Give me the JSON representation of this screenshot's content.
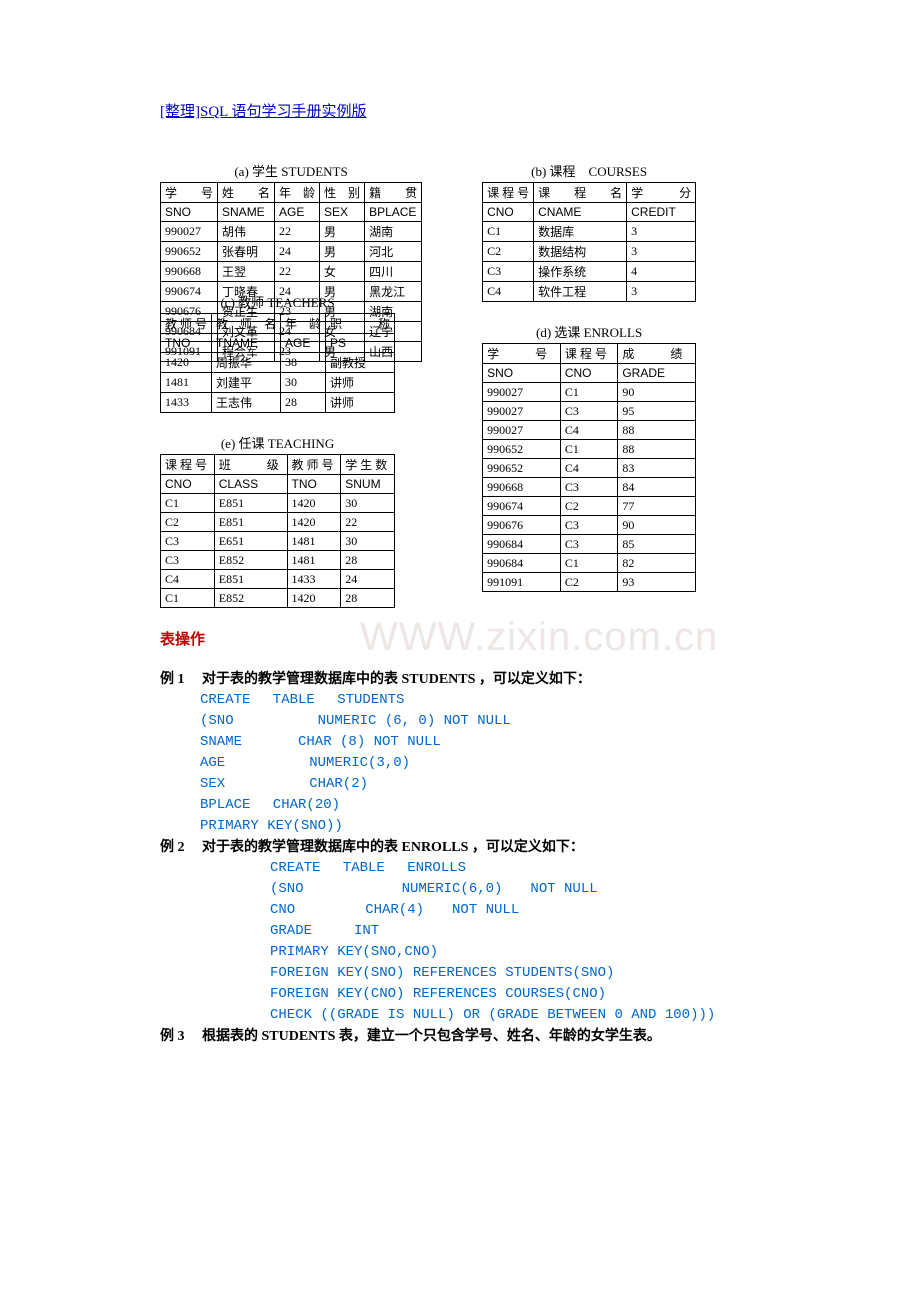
{
  "title": "[整理]SQL 语句学习手册实例版",
  "tbl_a": {
    "cap": "(a) 学生 STUDENTS",
    "h": [
      "学　　号",
      "姓　　名",
      "年　龄",
      "性　别",
      "籍　　贯"
    ],
    "h2": [
      "SNO",
      "SNAME",
      "AGE",
      "SEX",
      "BPLACE"
    ],
    "rows": [
      [
        "990027",
        "胡伟",
        "22",
        "男",
        "湖南"
      ],
      [
        "990652",
        "张春明",
        "24",
        "男",
        "河北"
      ],
      [
        "990668",
        "王翌",
        "22",
        "女",
        "四川"
      ],
      [
        "990674",
        "丁晓春",
        "24",
        "男",
        "黑龙江"
      ],
      [
        "990676",
        "贺正生",
        "23",
        "男",
        "湖南"
      ],
      [
        "990684",
        "刘文革",
        "24",
        "女",
        "辽宁"
      ],
      [
        "991091",
        "程会军",
        "23",
        "男",
        "山西"
      ]
    ]
  },
  "tbl_b": {
    "cap": "(b) 课程　COURSES",
    "h": [
      "课 程 号",
      "课　　程　　名",
      "学　　　分"
    ],
    "h2": [
      "CNO",
      "CNAME",
      "CREDIT"
    ],
    "rows": [
      [
        "C1",
        "数据库",
        "3"
      ],
      [
        "C2",
        "数据结构",
        "3"
      ],
      [
        "C3",
        "操作系统",
        "4"
      ],
      [
        "C4",
        "软件工程",
        "3"
      ]
    ]
  },
  "tbl_c": {
    "cap": "(c) 教师 TEACHERS",
    "h": [
      "教 师 号",
      "教　师　名",
      "年　龄",
      "职　　　称"
    ],
    "h2": [
      "TNO",
      "TNAME",
      "AGE",
      "PS"
    ],
    "rows": [
      [
        "1420",
        "周振华",
        "38",
        "副教授"
      ],
      [
        "1481",
        "刘建平",
        "30",
        "讲师"
      ],
      [
        "1433",
        "王志伟",
        "28",
        "讲师"
      ]
    ]
  },
  "tbl_d": {
    "cap": "(d) 选课 ENROLLS",
    "h": [
      "学　　　号",
      "课 程 号",
      "成　　　绩"
    ],
    "h2": [
      "SNO",
      "CNO",
      "GRADE"
    ],
    "rows": [
      [
        "990027",
        "C1",
        "90"
      ],
      [
        "990027",
        "C3",
        "95"
      ],
      [
        "990027",
        "C4",
        "88"
      ],
      [
        "990652",
        "C1",
        "88"
      ],
      [
        "990652",
        "C4",
        "83"
      ],
      [
        "990668",
        "C3",
        "84"
      ],
      [
        "990674",
        "C2",
        "77"
      ],
      [
        "990676",
        "C3",
        "90"
      ],
      [
        "990684",
        "C3",
        "85"
      ],
      [
        "990684",
        "C1",
        "82"
      ],
      [
        "991091",
        "C2",
        "93"
      ]
    ]
  },
  "tbl_e": {
    "cap": "(e) 任课 TEACHING",
    "h": [
      "课 程 号",
      "班　　　级",
      "教 师 号",
      "学 生 数"
    ],
    "h2": [
      "CNO",
      "CLASS",
      "TNO",
      "SNUM"
    ],
    "rows": [
      [
        "C1",
        "E851",
        "1420",
        "30"
      ],
      [
        "C2",
        "E851",
        "1420",
        "22"
      ],
      [
        "C3",
        "E651",
        "1481",
        "30"
      ],
      [
        "C3",
        "E852",
        "1481",
        "28"
      ],
      [
        "C4",
        "E851",
        "1433",
        "24"
      ],
      [
        "C1",
        "E852",
        "1420",
        "28"
      ]
    ]
  },
  "sec1": "表操作",
  "ex1": {
    "t": "例 1　 对于表的教学管理数据库中的表 STUDENTS ，可以定义如下：",
    "c": [
      "CREATE　 TABLE　 STUDENTS",
      "(SNO　　　　　　NUMERIC (6, 0) NOT NULL",
      "SNAME　　　　CHAR (8) NOT NULL",
      "AGE　　　　　　NUMERIC(3,0)",
      "SEX　　　　　　CHAR(2)",
      "BPLACE　 CHAR(20)",
      "PRIMARY KEY(SNO))"
    ]
  },
  "ex2": {
    "t": "例 2　 对于表的教学管理数据库中的表 ENROLLS ，可以定义如下：",
    "c": [
      "CREATE　 TABLE　 ENROLLS",
      "(SNO　　　　　　　NUMERIC(6,0)　　NOT NULL",
      "CNO　　　　　CHAR(4)　　NOT NULL",
      "GRADE　　　INT",
      "PRIMARY KEY(SNO,CNO)",
      "FOREIGN KEY(SNO) REFERENCES STUDENTS(SNO)",
      "FOREIGN KEY(CNO) REFERENCES COURSES(CNO)",
      "CHECK ((GRADE IS NULL) OR (GRADE BETWEEN 0 AND 100)))"
    ]
  },
  "ex3": {
    "t": "例 3　 根据表的 STUDENTS 表，建立一个只包含学号、姓名、年龄的女学生表。"
  },
  "wm": "WWW.zixin.com.cn"
}
